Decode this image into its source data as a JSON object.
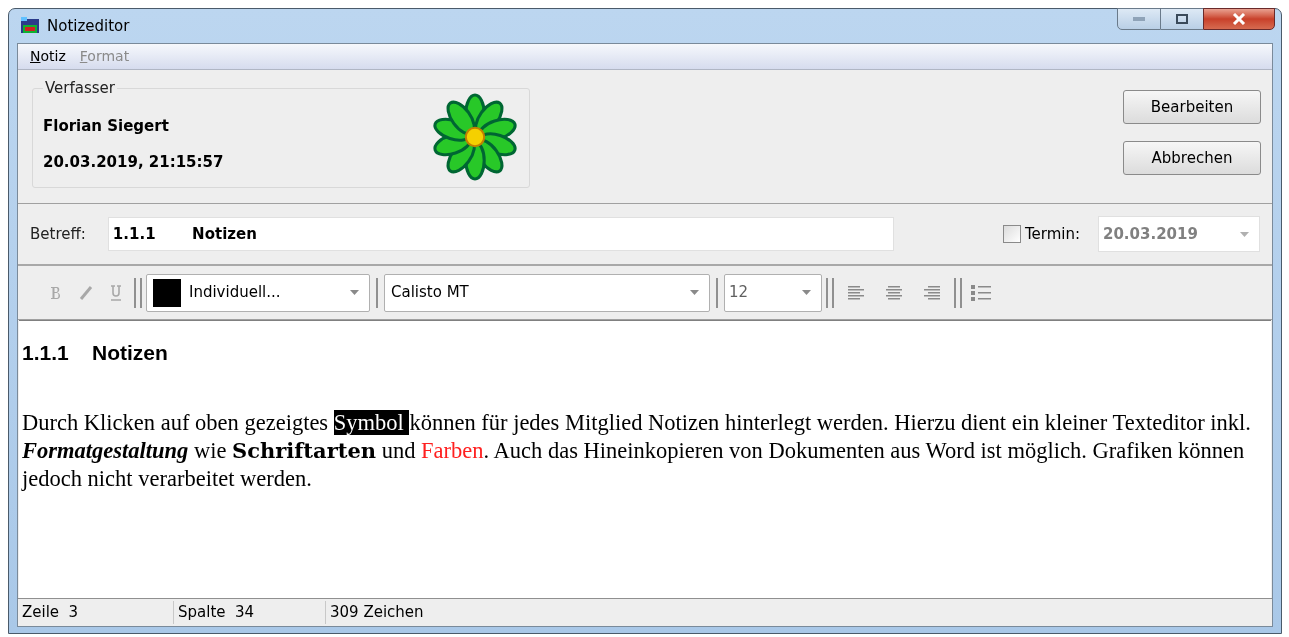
{
  "window": {
    "title": "Notizeditor"
  },
  "menu": [
    {
      "label": "Notiz",
      "disabled": false
    },
    {
      "label": "Format",
      "disabled": true
    }
  ],
  "author": {
    "label": "Verfasser",
    "name": "Florian Siegert",
    "datetime": "20.03.2019, 21:15:57"
  },
  "buttons": [
    "Bearbeiten",
    "Abbrechen"
  ],
  "subject": {
    "label": "Betreff:",
    "value": "1.1.1       Notizen"
  },
  "termin": {
    "label": "Termin:",
    "checked": false,
    "value": "20.03.2019",
    "disabled": true
  },
  "toolbar": {
    "format_buttons": [
      {
        "kind": "bold",
        "disabled": true
      },
      {
        "kind": "italic",
        "disabled": true
      },
      {
        "kind": "underline",
        "disabled": true
      }
    ],
    "color_combo": {
      "value": "Individuell...",
      "color": "#000000"
    },
    "font_combo": {
      "value": "Calisto MT"
    },
    "size_combo": {
      "value": "12",
      "disabled": true
    },
    "align_buttons": [
      {
        "kind": "left"
      },
      {
        "kind": "center"
      },
      {
        "kind": "right"
      }
    ],
    "list_button": {
      "kind": "bullets"
    }
  },
  "editor": {
    "heading": "1.1.1    Notizen",
    "paragraph": [
      {
        "kind": "plain",
        "text": "Durch Klicken auf oben gezeigtes "
      },
      {
        "kind": "highlight",
        "text": "Symbol "
      },
      {
        "kind": "plain",
        "text": "können für jedes Mitglied Notizen hinterlegt werden. Hierzu dient ein kleiner Texteditor inkl. "
      },
      {
        "kind": "bold_italic",
        "text": "Formatgestaltung"
      },
      {
        "kind": "plain",
        "text": " wie "
      },
      {
        "kind": "heavy",
        "text": "Schriftarten"
      },
      {
        "kind": "plain",
        "text": " und "
      },
      {
        "kind": "colored",
        "text": "Farben",
        "color": "#ff2020"
      },
      {
        "kind": "plain",
        "text": ". Auch das Hineinkopieren von Dokumenten aus Word ist möglich. Grafiken können jedoch nicht verarbeitet werden."
      }
    ]
  },
  "status_bar": [
    "Zeile  3",
    "Spalte  34",
    "309 Zeichen"
  ]
}
